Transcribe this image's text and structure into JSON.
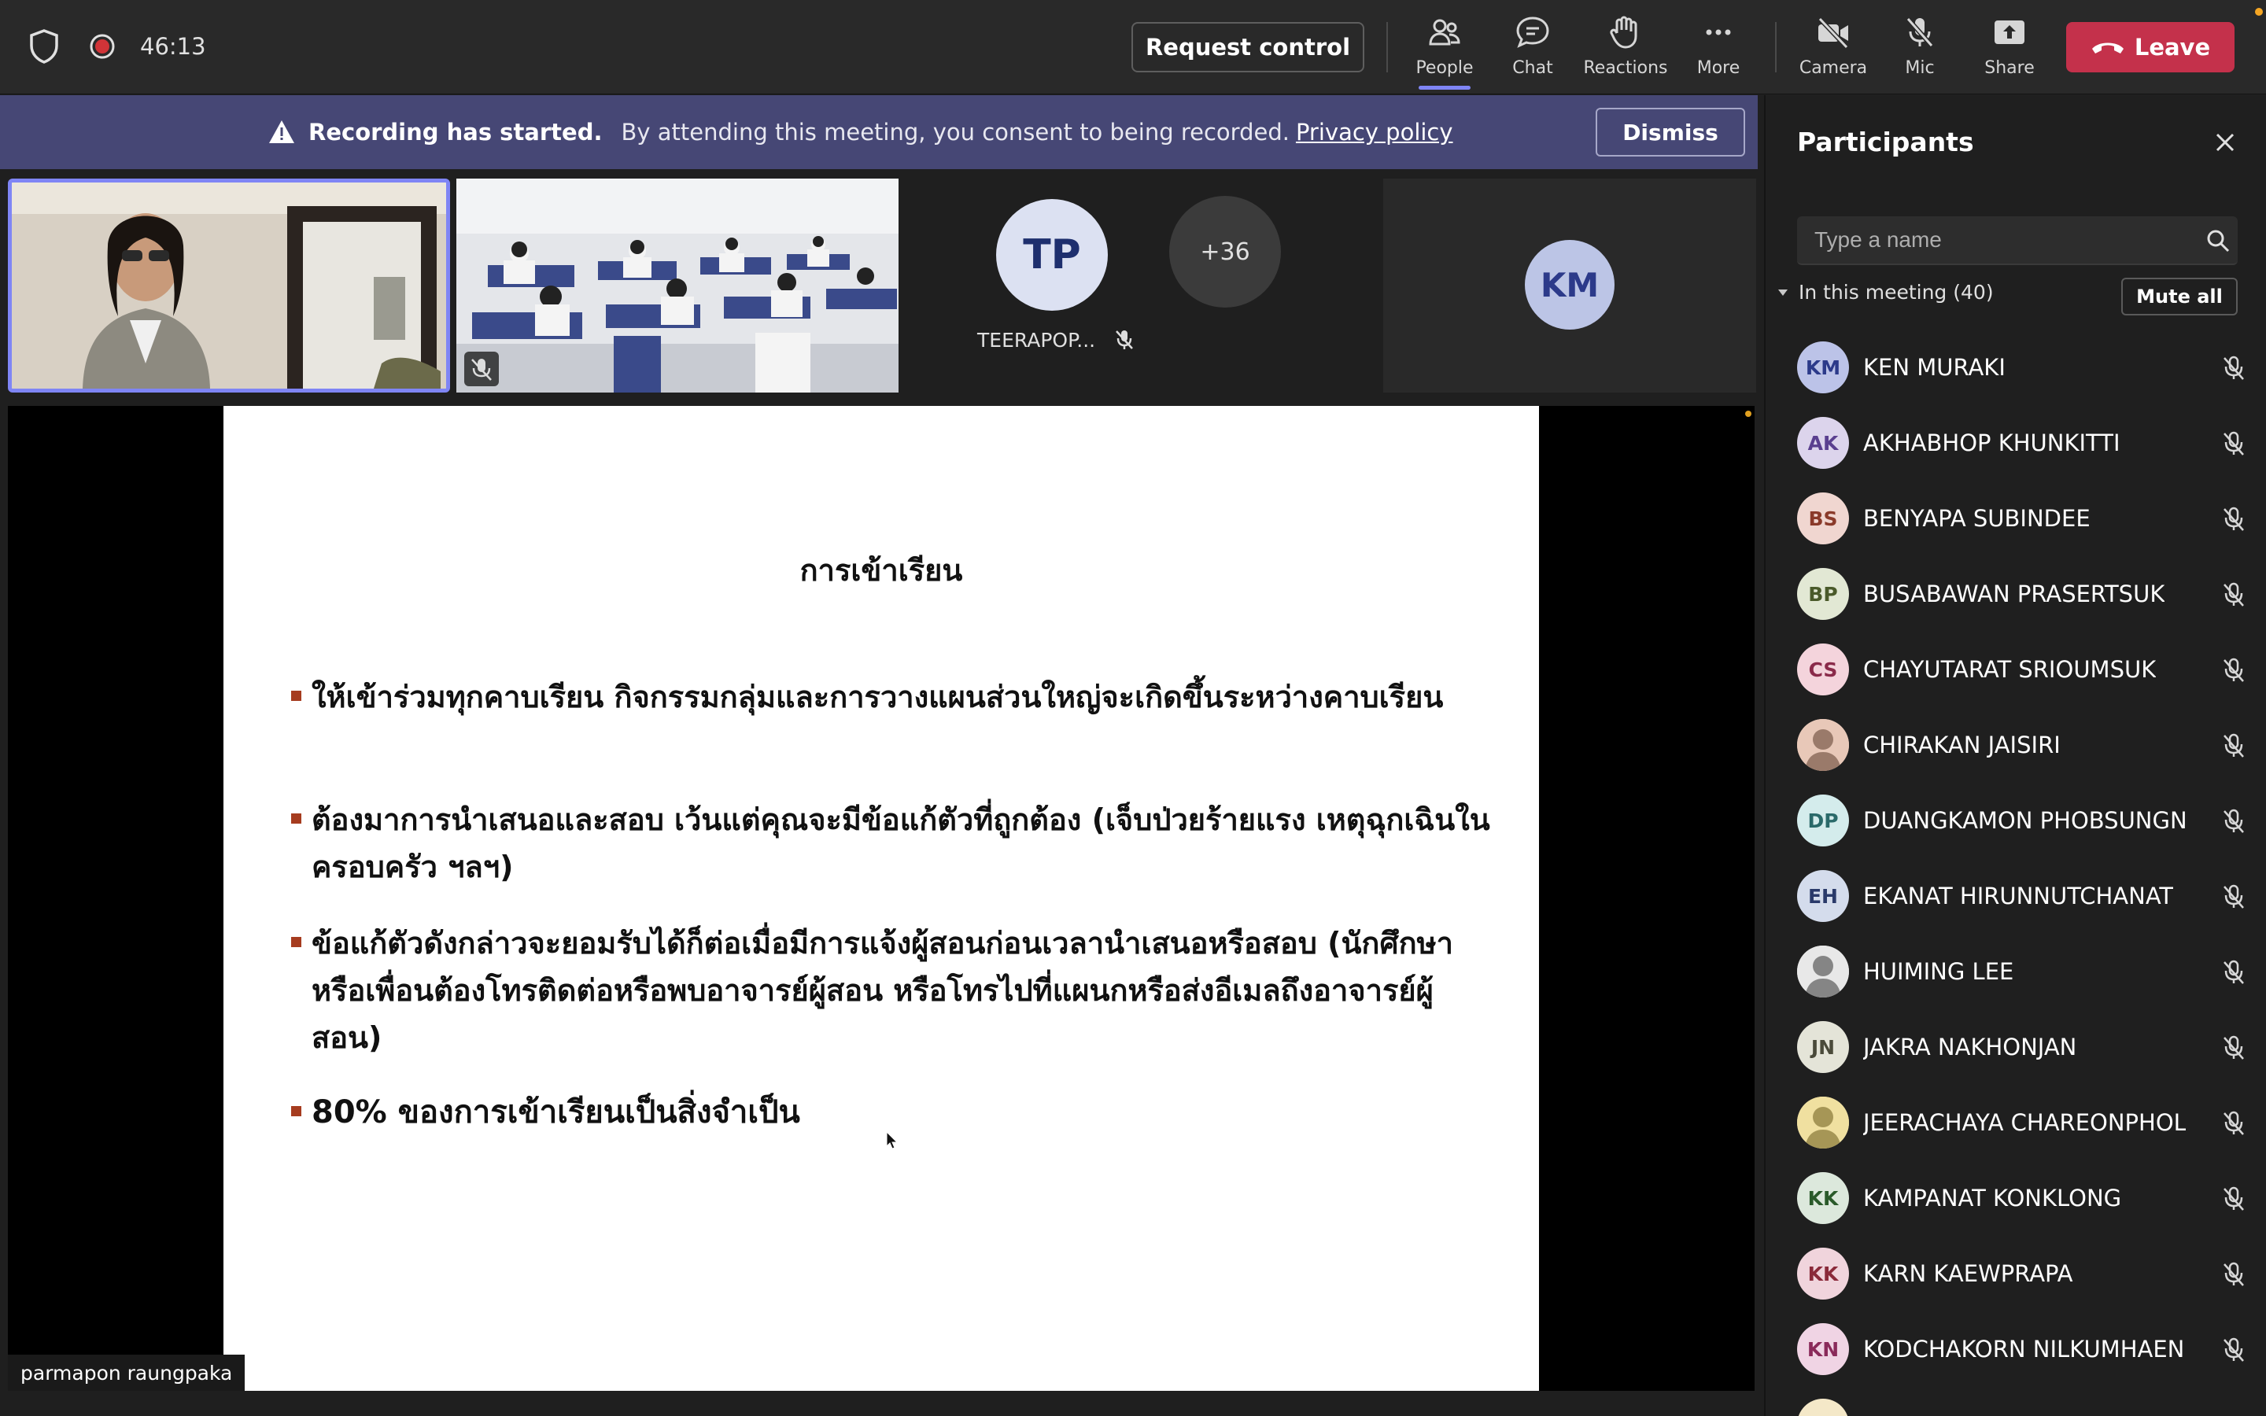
{
  "topbar": {
    "timer": "46:13",
    "request_control": "Request control",
    "buttons": [
      {
        "label": "People",
        "icon": "people-icon"
      },
      {
        "label": "Chat",
        "icon": "chat-icon"
      },
      {
        "label": "Reactions",
        "icon": "reactions-icon"
      },
      {
        "label": "More",
        "icon": "more-icon"
      },
      {
        "label": "Camera",
        "icon": "camera-off-icon"
      },
      {
        "label": "Mic",
        "icon": "mic-off-icon"
      },
      {
        "label": "Share",
        "icon": "share-icon"
      }
    ],
    "leave": "Leave"
  },
  "banner": {
    "bold": "Recording has started.",
    "text": "By attending this meeting, you consent to being recorded.",
    "link": "Privacy policy",
    "dismiss": "Dismiss"
  },
  "tiles": {
    "tp_initials": "TP",
    "tp_name": "TEERAPOP...",
    "overflow": "+36",
    "km_initials": "KM"
  },
  "slide": {
    "title": "การเข้าเรียน",
    "bullets": [
      "ให้เข้าร่วมทุกคาบเรียน กิจกรรมกลุ่มและการวางแผนส่วนใหญ่จะเกิดขึ้นระหว่างคาบเรียน",
      "ต้องมาการนำเสนอและสอบ เว้นแต่คุณจะมีข้อแก้ตัวที่ถูกต้อง (เจ็บป่วยร้ายแรง เหตุฉุกเฉินในครอบครัว ฯลฯ)",
      "ข้อแก้ตัวดังกล่าวจะยอมรับได้ก็ต่อเมื่อมีการแจ้งผู้สอนก่อนเวลานำเสนอหรือสอบ (นักศึกษาหรือเพื่อนต้องโทรติดต่อหรือพบอาจารย์ผู้สอน หรือโทรไปที่แผนกหรือส่งอีเมลถึงอาจารย์ผู้สอน)",
      "80% ของการเข้าเรียนเป็นสิ่งจำเป็น"
    ]
  },
  "presenter_name": "parmapon raungpaka",
  "panel": {
    "title": "Participants",
    "search_placeholder": "Type a name",
    "section": "In this meeting (40)",
    "mute_all": "Mute all",
    "participants": [
      {
        "initials": "KM",
        "name": "KEN MURAKI",
        "bg": "#bcc3e8",
        "fg": "#2c3a8a"
      },
      {
        "initials": "AK",
        "name": "AKHABHOP KHUNKITTI",
        "bg": "#dcd4ec",
        "fg": "#5a3f8f"
      },
      {
        "initials": "BS",
        "name": "BENYAPA SUBINDEE",
        "bg": "#f0d6d0",
        "fg": "#8a3a2a"
      },
      {
        "initials": "BP",
        "name": "BUSABAWAN PRASERTSUK",
        "bg": "#e2e8d4",
        "fg": "#4a5a2a"
      },
      {
        "initials": "CS",
        "name": "CHAYUTARAT SRIOUMSUK",
        "bg": "#f4d4dc",
        "fg": "#8a2a4a"
      },
      {
        "initials": "",
        "name": "CHIRAKAN JAISIRI",
        "bg": "#e8c8b8",
        "fg": "#5a3a2a",
        "photo": true
      },
      {
        "initials": "DP",
        "name": "DUANGKAMON PHOBSUNGN...",
        "bg": "#d4ecec",
        "fg": "#2a6a6a"
      },
      {
        "initials": "EH",
        "name": "EKANAT HIRUNNUTCHANAT",
        "bg": "#d4dcec",
        "fg": "#2a3a6a"
      },
      {
        "initials": "",
        "name": "HUIMING LEE",
        "bg": "#e8e8e8",
        "fg": "#333",
        "photo": true
      },
      {
        "initials": "JN",
        "name": "JAKRA NAKHONJAN",
        "bg": "#e4e4d8",
        "fg": "#4a4a3a"
      },
      {
        "initials": "",
        "name": "JEERACHAYA CHAREONPHOL",
        "bg": "#f0e0a0",
        "fg": "#6a5a1a",
        "photo": true
      },
      {
        "initials": "KK",
        "name": "KAMPANAT KONKLONG",
        "bg": "#dce8dc",
        "fg": "#2a5a2a"
      },
      {
        "initials": "KK",
        "name": "KARN KAEWPRAPA",
        "bg": "#f0d4dc",
        "fg": "#8a2a3a"
      },
      {
        "initials": "KN",
        "name": "KODCHAKORN NILKUMHAENG",
        "bg": "#f0d4e4",
        "fg": "#8a2a5a"
      },
      {
        "initials": "",
        "name": "",
        "bg": "#f4e8c8",
        "fg": "#6a5a2a"
      }
    ]
  }
}
